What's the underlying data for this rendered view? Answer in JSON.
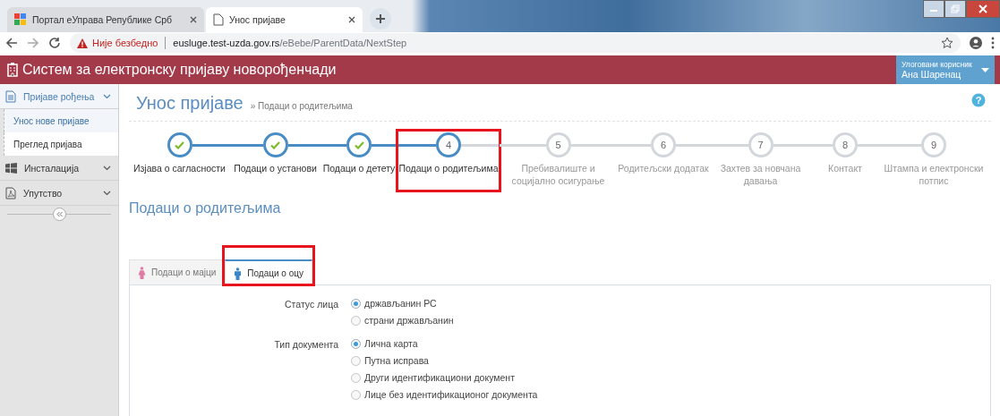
{
  "browser": {
    "tabs": [
      {
        "title": "Портал еУправа Републике Срб",
        "selected": false,
        "kind": "google"
      },
      {
        "title": "Унос пријаве",
        "selected": true,
        "kind": "page"
      }
    ],
    "security_label": "Није безбедно",
    "url_host": "eusluge.test-uzda.gov.rs",
    "url_path": "/eBebe/ParentData/NextStep"
  },
  "help_icon": "?",
  "app": {
    "title": "Систем за електронску пријаву новорођенчади",
    "user": {
      "label": "Улоговани корисник",
      "name": "Ана Шаренац"
    }
  },
  "sidebar": {
    "items": [
      {
        "label": "Пријаве рођења",
        "kind": "document",
        "expanded": true,
        "children": [
          {
            "label": "Унос нове пријаве",
            "selected": true
          },
          {
            "label": "Преглед пријава",
            "selected": false
          }
        ]
      },
      {
        "label": "Инсталација",
        "kind": "windows",
        "expanded": false
      },
      {
        "label": "Упутство",
        "kind": "pdf",
        "expanded": false
      }
    ]
  },
  "page": {
    "title": "Унос пријаве",
    "breadcrumb": "» Подаци о родитељима",
    "steps": [
      {
        "label": "Изјава о сагласности",
        "kind": "done",
        "highlighted": false
      },
      {
        "label": "Подаци о установи",
        "kind": "done",
        "highlighted": false
      },
      {
        "label": "Подаци о детету",
        "kind": "done",
        "highlighted": false
      },
      {
        "number": "4",
        "label": "Подаци о родитељима",
        "kind": "current",
        "highlighted": true
      },
      {
        "number": "5",
        "label": "Пребивалиште и социјално осигурање",
        "kind": "pending",
        "highlighted": false
      },
      {
        "number": "6",
        "label": "Родитељски додатак",
        "kind": "pending",
        "highlighted": false
      },
      {
        "number": "7",
        "label": "Захтев за новчана давања",
        "kind": "pending",
        "highlighted": false
      },
      {
        "number": "8",
        "label": "Контакт",
        "kind": "pending",
        "highlighted": false
      },
      {
        "number": "9",
        "label": "Штампа и електронски потпис",
        "kind": "pending",
        "highlighted": false
      }
    ],
    "section_title": "Подаци о родитељима",
    "form_tabs": [
      {
        "label": "Подаци о мајци",
        "kind": "female",
        "selected": false,
        "highlighted": false
      },
      {
        "label": "Подаци о оцу",
        "kind": "male",
        "selected": true,
        "highlighted": true
      }
    ],
    "fields": [
      {
        "label": "Статус лица",
        "options": [
          {
            "label": "држављанин РС",
            "selected": true
          },
          {
            "label": "страни држављанин",
            "selected": false
          }
        ]
      },
      {
        "label": "Тип документа",
        "options": [
          {
            "label": "Лична карта",
            "selected": true
          },
          {
            "label": "Путна исправа",
            "selected": false
          },
          {
            "label": "Други идентификациони документ",
            "selected": false
          },
          {
            "label": "Лице без идентификационог документа",
            "selected": false
          }
        ]
      }
    ]
  }
}
